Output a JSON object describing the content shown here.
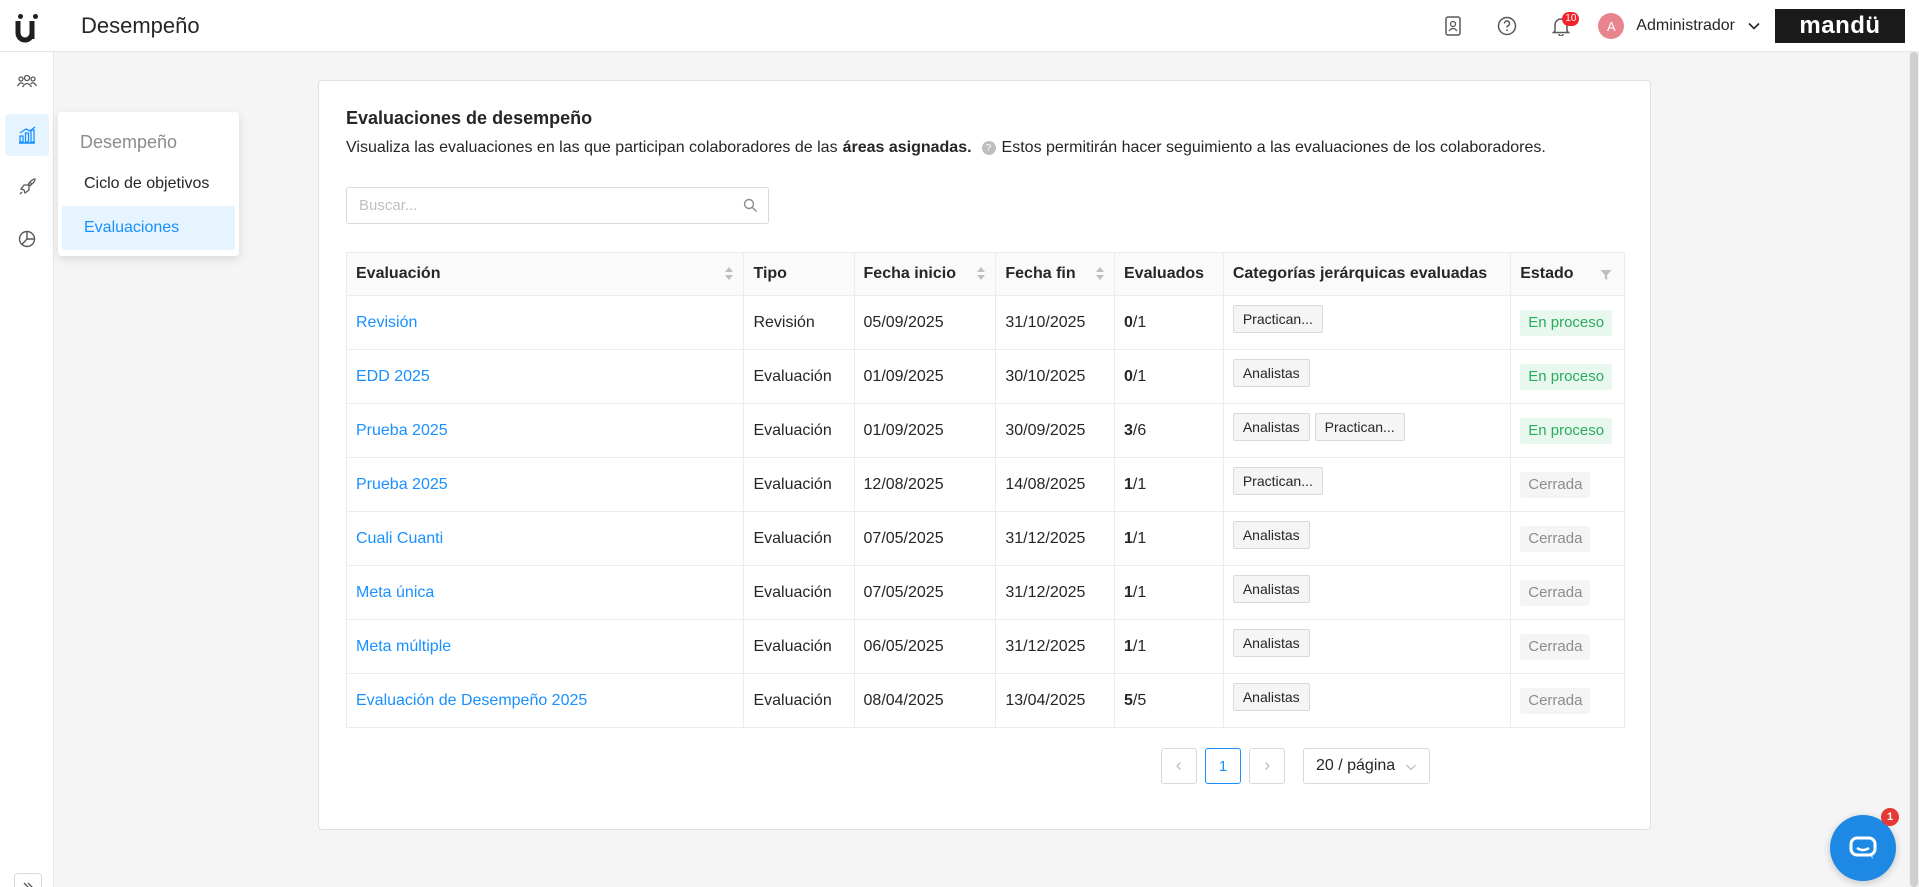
{
  "header": {
    "title": "Desempeño",
    "notifications_count": "10",
    "user_initial": "A",
    "user_name": "Administrador",
    "brand": "mandü"
  },
  "rail": {
    "items": [
      "people-icon",
      "chart-icon",
      "rocket-icon",
      "pie-chart-icon"
    ],
    "active": "chart-icon"
  },
  "submenu": {
    "title": "Desempeño",
    "items": [
      {
        "label": "Ciclo de objetivos",
        "active": false
      },
      {
        "label": "Evaluaciones",
        "active": true
      }
    ]
  },
  "main": {
    "title": "Evaluaciones de desempeño",
    "description_prefix": "Visualiza las evaluaciones en las que participan colaboradores de las",
    "description_bold": "áreas asignadas.",
    "help_symbol": "?",
    "description_suffix": "Estos permitirán hacer seguimiento a las evaluaciones de los colaboradores.",
    "search_placeholder": "Buscar..."
  },
  "table": {
    "columns": [
      "Evaluación",
      "Tipo",
      "Fecha inicio",
      "Fecha fin",
      "Evaluados",
      "Categorías jerárquicas evaluadas",
      "Estado"
    ],
    "rows": [
      {
        "name": "Revisión",
        "type": "Revisión",
        "start": "05/09/2025",
        "end": "31/10/2025",
        "done": "0",
        "total": "/1",
        "tags": [
          "Practican..."
        ],
        "status": "En proceso"
      },
      {
        "name": "EDD 2025",
        "type": "Evaluación",
        "start": "01/09/2025",
        "end": "30/10/2025",
        "done": "0",
        "total": "/1",
        "tags": [
          "Analistas"
        ],
        "status": "En proceso"
      },
      {
        "name": "Prueba 2025",
        "type": "Evaluación",
        "start": "01/09/2025",
        "end": "30/09/2025",
        "done": "3",
        "total": "/6",
        "tags": [
          "Analistas",
          "Practican..."
        ],
        "status": "En proceso"
      },
      {
        "name": "Prueba 2025",
        "type": "Evaluación",
        "start": "12/08/2025",
        "end": "14/08/2025",
        "done": "1",
        "total": "/1",
        "tags": [
          "Practican..."
        ],
        "status": "Cerrada"
      },
      {
        "name": "Cuali Cuanti",
        "type": "Evaluación",
        "start": "07/05/2025",
        "end": "31/12/2025",
        "done": "1",
        "total": "/1",
        "tags": [
          "Analistas"
        ],
        "status": "Cerrada"
      },
      {
        "name": "Meta única",
        "type": "Evaluación",
        "start": "07/05/2025",
        "end": "31/12/2025",
        "done": "1",
        "total": "/1",
        "tags": [
          "Analistas"
        ],
        "status": "Cerrada"
      },
      {
        "name": "Meta múltiple",
        "type": "Evaluación",
        "start": "06/05/2025",
        "end": "31/12/2025",
        "done": "1",
        "total": "/1",
        "tags": [
          "Analistas"
        ],
        "status": "Cerrada"
      },
      {
        "name": "Evaluación de Desempeño 2025",
        "type": "Evaluación",
        "start": "08/04/2025",
        "end": "13/04/2025",
        "done": "5",
        "total": "/5",
        "tags": [
          "Analistas"
        ],
        "status": "Cerrada"
      }
    ]
  },
  "pagination": {
    "current_page": "1",
    "page_size": "20 / página"
  },
  "chat": {
    "badge": "1"
  },
  "colors": {
    "accent": "#1890ff",
    "status_open": "#2aab5e",
    "status_closed": "#8c8c8c"
  }
}
